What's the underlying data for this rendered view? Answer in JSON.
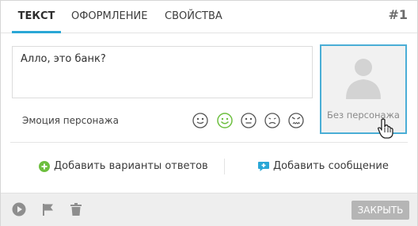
{
  "tabs": [
    {
      "label": "Текст",
      "active": true
    },
    {
      "label": "Оформление",
      "active": false
    },
    {
      "label": "Свойства",
      "active": false
    }
  ],
  "message_number": "#1",
  "message_text": "Алло, это банк?",
  "emotion": {
    "label": "Эмоция персонажа",
    "icons": [
      "neutral-happy",
      "happy-selected",
      "neutral",
      "sad",
      "angry"
    ]
  },
  "avatar": {
    "label": "Без персонажа"
  },
  "actions": {
    "add_answers": "Добавить варианты ответов",
    "add_message": "Добавить сообщение"
  },
  "footer": {
    "close_label": "Закрыть"
  },
  "colors": {
    "accent": "#2aa7d6",
    "green": "#6dbf3f",
    "close_bg": "#b5b5b5"
  }
}
